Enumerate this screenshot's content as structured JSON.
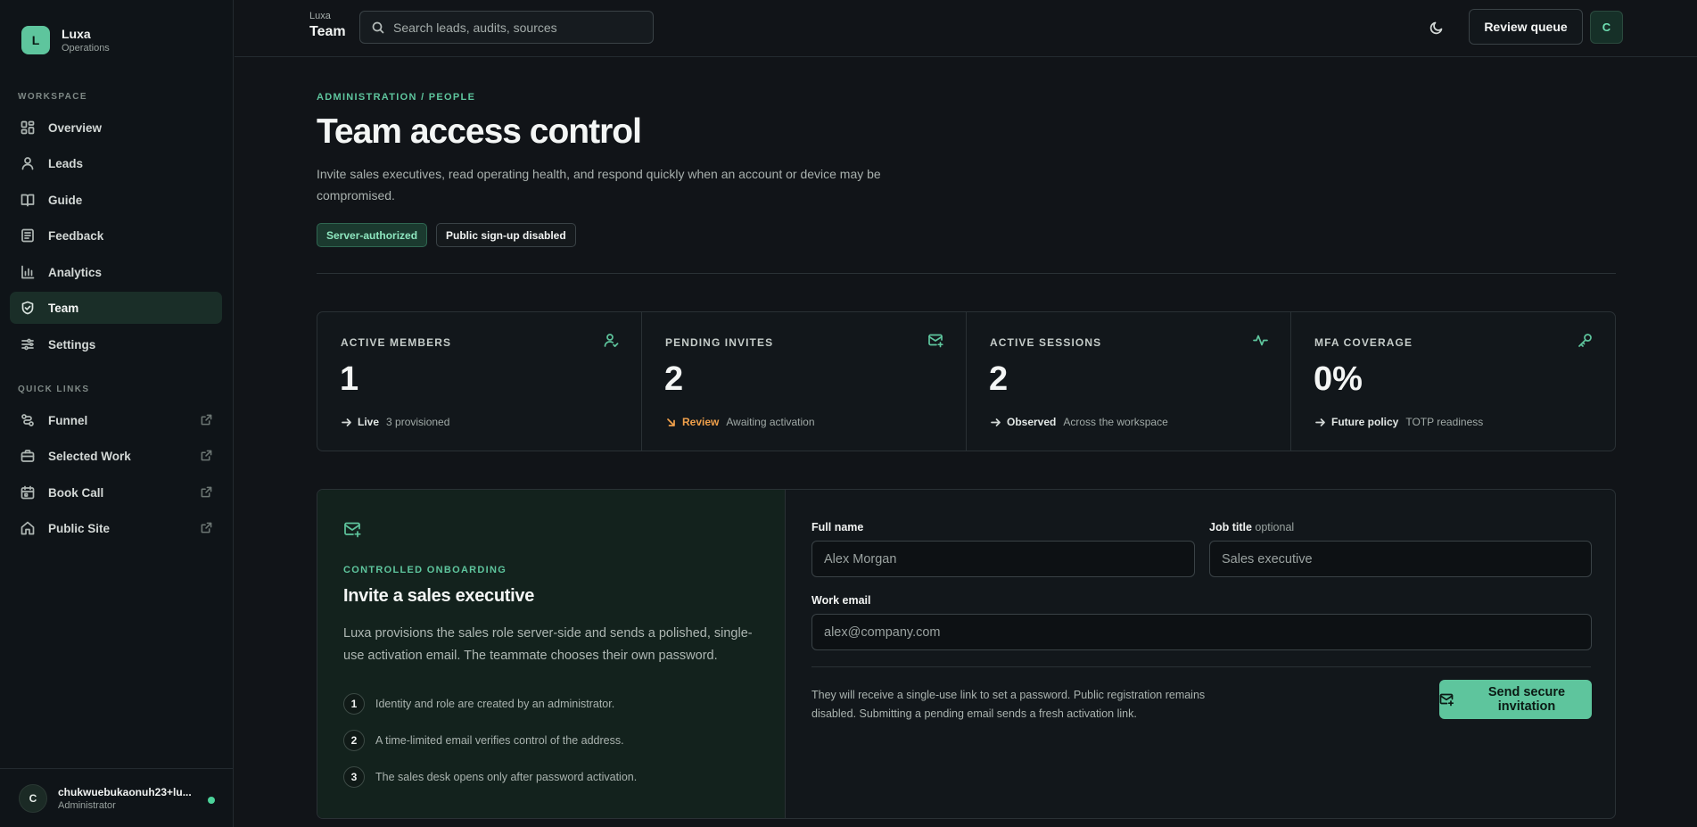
{
  "colors": {
    "accent": "#5ec59d",
    "warning": "#f0a04b",
    "background": "#111418",
    "online": "#4cd39a"
  },
  "brand": {
    "initial": "L",
    "name": "Luxa",
    "subtitle": "Operations"
  },
  "sidebar": {
    "workspace_label": "WORKSPACE",
    "items": [
      {
        "label": "Overview",
        "icon": "dashboard-icon"
      },
      {
        "label": "Leads",
        "icon": "user-icon"
      },
      {
        "label": "Guide",
        "icon": "book-icon"
      },
      {
        "label": "Feedback",
        "icon": "feedback-icon"
      },
      {
        "label": "Analytics",
        "icon": "bar-chart-icon"
      },
      {
        "label": "Team",
        "icon": "shield-icon",
        "active": true
      },
      {
        "label": "Settings",
        "icon": "settings-sliders-icon"
      }
    ],
    "quick_links_label": "QUICK LINKS",
    "quick_links": [
      {
        "label": "Funnel",
        "icon": "funnel-icon"
      },
      {
        "label": "Selected Work",
        "icon": "briefcase-icon"
      },
      {
        "label": "Book Call",
        "icon": "calendar-icon"
      },
      {
        "label": "Public Site",
        "icon": "home-icon"
      }
    ]
  },
  "user": {
    "initial": "C",
    "name": "chukwuebukaonuh23+lu...",
    "role": "Administrator"
  },
  "topbar": {
    "crumb_small": "Luxa",
    "crumb_big": "Team",
    "search_placeholder": "Search leads, audits, sources",
    "review_label": "Review queue",
    "avatar_initial": "C"
  },
  "header": {
    "eyebrow": "ADMINISTRATION / PEOPLE",
    "title": "Team access control",
    "description": "Invite sales executives, read operating health, and respond quickly when an account or device may be compromised.",
    "badges": [
      "Server-authorized",
      "Public sign-up disabled"
    ]
  },
  "stats": [
    {
      "label": "ACTIVE MEMBERS",
      "value": "1",
      "tag": "Live",
      "note": "3 provisioned",
      "icon": "user-check-icon"
    },
    {
      "label": "PENDING INVITES",
      "value": "2",
      "tag": "Review",
      "note": "Awaiting activation",
      "icon": "mail-plus-icon"
    },
    {
      "label": "ACTIVE SESSIONS",
      "value": "2",
      "tag": "Observed",
      "note": "Across the workspace",
      "icon": "activity-icon"
    },
    {
      "label": "MFA COVERAGE",
      "value": "0%",
      "tag": "Future policy",
      "note": "TOTP readiness",
      "icon": "key-icon"
    }
  ],
  "invite": {
    "eyebrow": "CONTROLLED ONBOARDING",
    "title": "Invite a sales executive",
    "description": "Luxa provisions the sales role server-side and sends a polished, single-use activation email. The teammate chooses their own password.",
    "steps": [
      {
        "num": "1",
        "text": "Identity and role are created by an administrator."
      },
      {
        "num": "2",
        "text": "A time-limited email verifies control of the address."
      },
      {
        "num": "3",
        "text": "The sales desk opens only after password activation."
      }
    ],
    "form": {
      "full_name_label": "Full name",
      "full_name_placeholder": "Alex Morgan",
      "job_title_label": "Job title",
      "job_title_optional": "optional",
      "job_title_placeholder": "Sales executive",
      "email_label": "Work email",
      "email_placeholder": "alex@company.com",
      "note": "They will receive a single-use link to set a password. Public registration remains disabled. Submitting a pending email sends a fresh activation link.",
      "submit_label": "Send secure invitation"
    }
  }
}
